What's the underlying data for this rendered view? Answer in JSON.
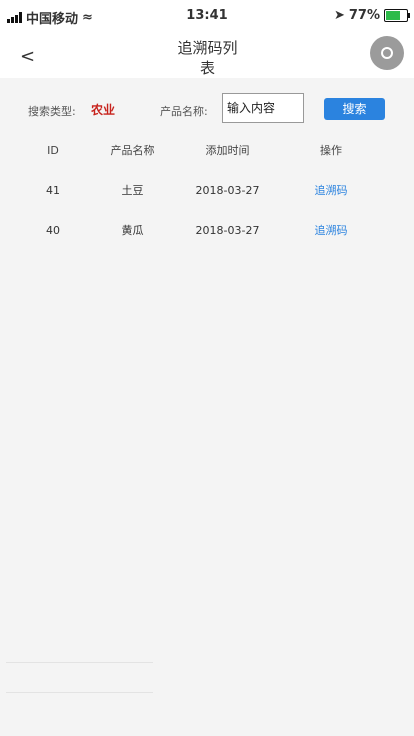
{
  "status_bar": {
    "carrier": "中国移动",
    "time": "13:41",
    "battery_percent": "77%",
    "battery_level": 0.77
  },
  "navbar": {
    "back_label": "<",
    "title_line1": "追溯码列",
    "title_line2": "表"
  },
  "filter": {
    "search_type_label": "搜索类型:",
    "search_type_value": "农业",
    "product_name_label": "产品名称:",
    "product_name_placeholder": "输入内容",
    "search_button": "搜索"
  },
  "table": {
    "headers": [
      "ID",
      "产品名称",
      "添加时间",
      "操作"
    ],
    "rows": [
      {
        "id": "41",
        "name": "土豆",
        "date": "2018-03-27",
        "action": "追溯码"
      },
      {
        "id": "40",
        "name": "黄瓜",
        "date": "2018-03-27",
        "action": "追溯码"
      }
    ]
  },
  "colors": {
    "accent": "#2b83df",
    "category_red": "#c7221c",
    "background": "#f4f4f4"
  }
}
